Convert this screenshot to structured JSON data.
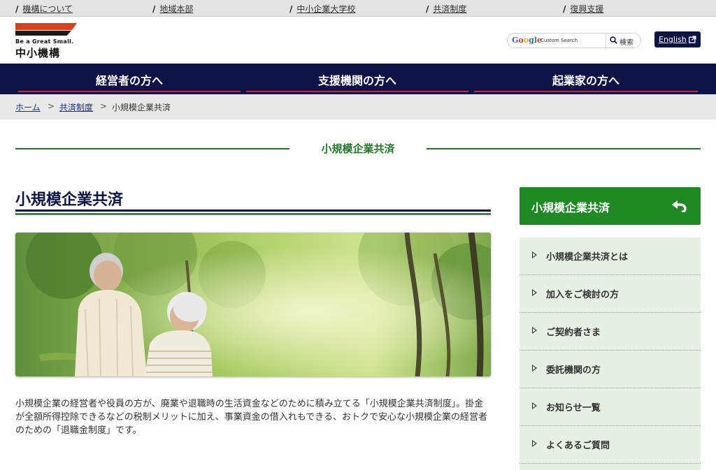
{
  "top_links": [
    "機構について",
    "地域本部",
    "中小企業大学校",
    "共済制度",
    "復興支援"
  ],
  "logo": {
    "tagline": "Be a Great Small.",
    "name": "中小機構"
  },
  "search": {
    "brand": "Google",
    "placeholder": "Custom Search",
    "button_label": "検索"
  },
  "english_label": "English",
  "main_nav": [
    "経営者の方へ",
    "支援機関の方へ",
    "起業家の方へ"
  ],
  "breadcrumb": {
    "home": "ホーム",
    "parent": "共済制度",
    "current": "小規模企業共済",
    "separator": ">"
  },
  "section_title": "小規模企業共済",
  "page_title": "小規模企業共済",
  "intro_text": "小規模企業の経営者や役員の方が、廃業や退職時の生活資金などのために積み立てる「小規模企業共済制度」。掛金が全額所得控除できるなどの税制メリットに加え、事業資金の借入れもできる、おトクで安心な小規模企業の経営者のための「退職金制度」です。",
  "side_menu": {
    "header": "小規模企業共済",
    "header_icon": "return-arrow-icon",
    "items": [
      "小規模企業共済とは",
      "加入をご検討の方",
      "ご契約者さま",
      "委託機関の方",
      "お知らせ一覧",
      "よくあるご質問"
    ]
  },
  "colors": {
    "navy": "#0d1445",
    "green": "#1f8a24",
    "accent_red": "#cf2a3a",
    "side_bg": "#e6f1e4"
  }
}
